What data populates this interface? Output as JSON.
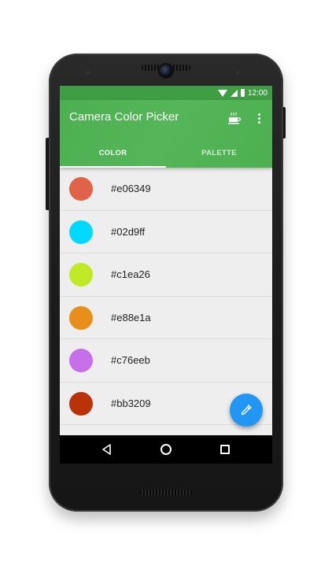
{
  "status_bar": {
    "time": "12:00"
  },
  "app_bar": {
    "title": "Camera Color Picker",
    "icons": [
      "coffee-icon",
      "overflow-menu-icon"
    ]
  },
  "tabs": [
    {
      "label": "COLOR",
      "active": true
    },
    {
      "label": "PALETTE",
      "active": false
    }
  ],
  "colors": [
    {
      "hex": "#e06349",
      "swatch": "#e06349"
    },
    {
      "hex": "#02d9ff",
      "swatch": "#02d9ff"
    },
    {
      "hex": "#c1ea26",
      "swatch": "#c1ea26"
    },
    {
      "hex": "#e88e1a",
      "swatch": "#e88e1a"
    },
    {
      "hex": "#c76eeb",
      "swatch": "#c76eeb"
    },
    {
      "hex": "#bb3209",
      "swatch": "#bb3209"
    }
  ],
  "fab": {
    "icon": "eyedropper-icon"
  },
  "nav_bar": {
    "icons": [
      "back-icon",
      "home-icon",
      "recents-icon"
    ]
  },
  "theme": {
    "primary": "#4caf50",
    "primary_dark": "#3f9d43",
    "accent": "#2196f3"
  }
}
